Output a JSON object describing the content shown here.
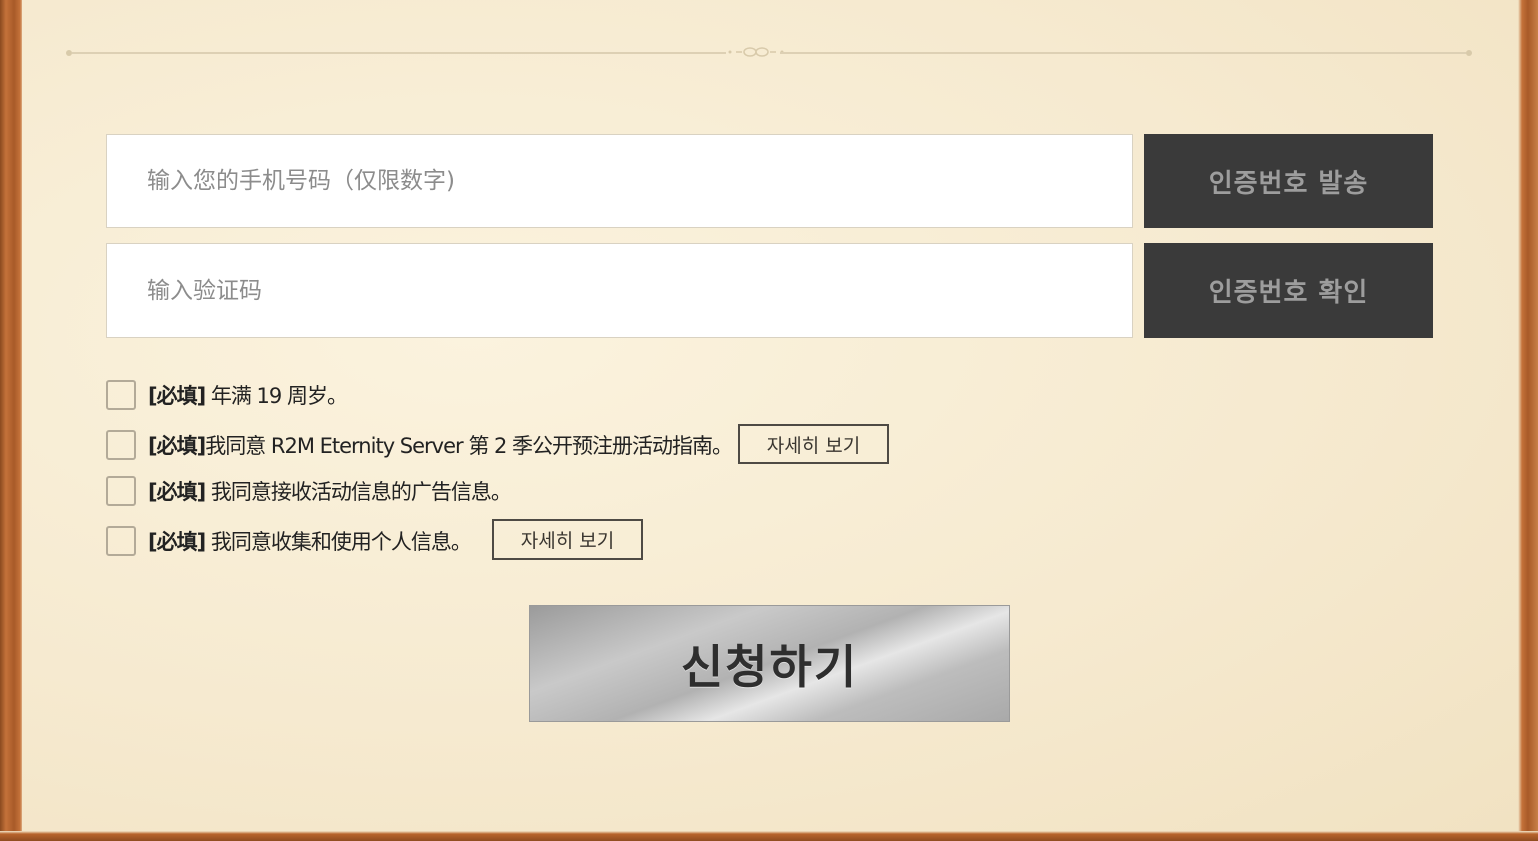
{
  "phone": {
    "placeholder": "输入您的手机号码（仅限数字)",
    "send_button": "인증번호 발송"
  },
  "code": {
    "placeholder": "输入验证码",
    "confirm_button": "인증번호 확인"
  },
  "agreements": [
    {
      "prefix": "[必填]",
      "text": " 年满 19 周岁。"
    },
    {
      "prefix": "[必填]",
      "text": "我同意 R2M Eternity Server 第 2 季公开预注册活动指南。",
      "detail_button": "자세히 보기"
    },
    {
      "prefix": "[必填]",
      "text": " 我同意接收活动信息的广告信息。"
    },
    {
      "prefix": "[必填]",
      "text": " 我同意收集和使用个人信息。",
      "detail_button": "자세히 보기"
    }
  ],
  "submit_label": "신청하기",
  "colors": {
    "frame": "#a85a28",
    "paper": "#f6ead0",
    "dark_button": "#3a3a3a",
    "dark_button_text": "#9d9d9d"
  }
}
